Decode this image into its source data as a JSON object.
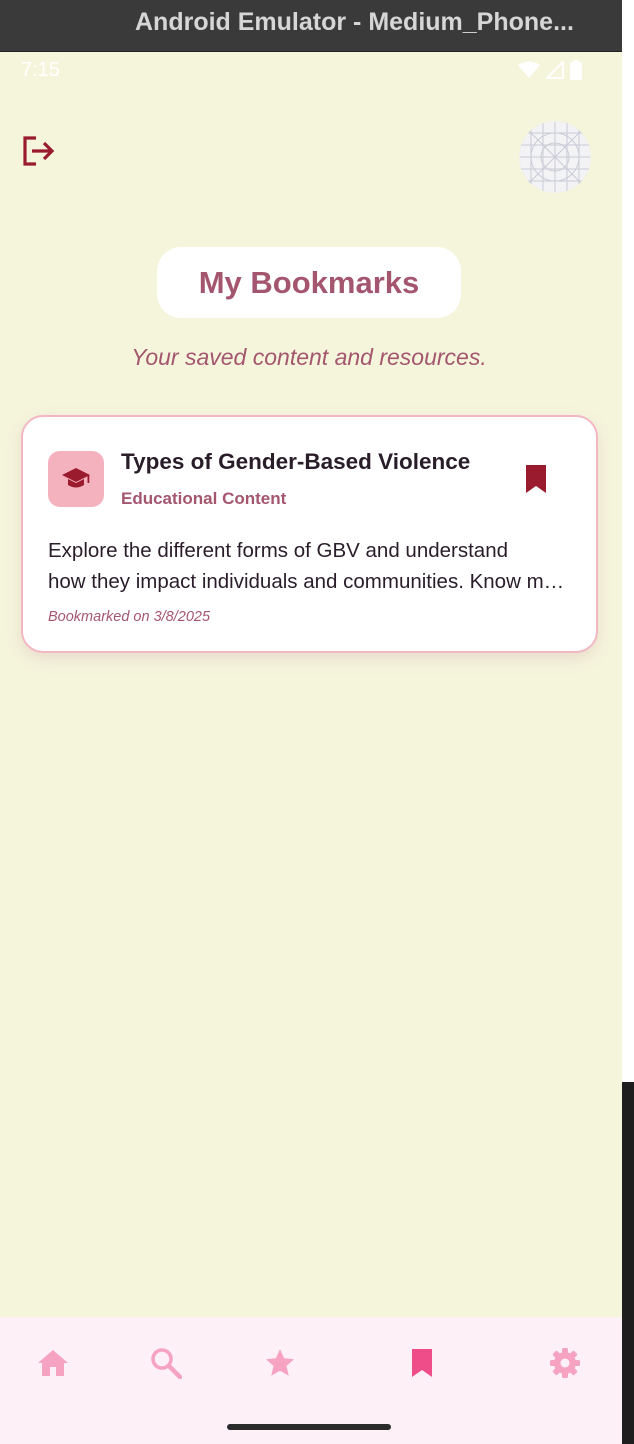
{
  "window": {
    "title": "Android Emulator - Medium_Phone..."
  },
  "status_bar": {
    "time": "7:15",
    "icons": [
      "wifi-icon",
      "signal-icon",
      "battery-icon"
    ]
  },
  "header": {
    "logout_icon": "logout-icon",
    "avatar_icon": "avatar-icon"
  },
  "page": {
    "title": "My Bookmarks",
    "subtitle": "Your saved content and resources."
  },
  "bookmarks": [
    {
      "icon": "graduation-cap-icon",
      "title": "Types of Gender-Based Violence",
      "category": "Educational Content",
      "description_line1": "Explore the different forms of GBV and understand",
      "description_line2": "how they impact individuals and communities. Know more about it",
      "bookmarked_date": "Bookmarked on 3/8/2025",
      "bookmark_icon": "bookmark-filled-icon"
    }
  ],
  "nav": {
    "items": [
      {
        "icon": "home-icon",
        "active": false
      },
      {
        "icon": "search-icon",
        "active": false
      },
      {
        "icon": "star-icon",
        "active": false
      },
      {
        "icon": "bookmark-icon",
        "active": true
      },
      {
        "icon": "gear-icon",
        "active": false
      }
    ]
  },
  "colors": {
    "background": "#f5f5dc",
    "accent": "#a4566f",
    "icon_red": "#9b1b2e",
    "nav_inactive": "#f5a3c0",
    "nav_active": "#ee4d8a",
    "card_border": "#f3b7c3"
  }
}
